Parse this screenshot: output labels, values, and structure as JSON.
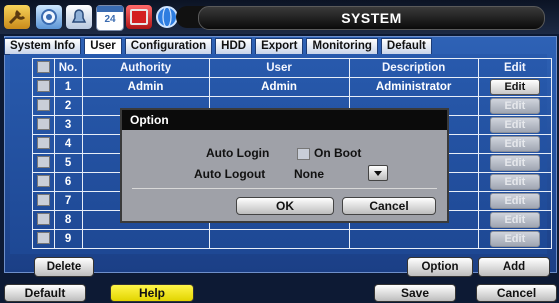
{
  "window": {
    "title": "SYSTEM"
  },
  "toolbar_icons": [
    "wrench-icon",
    "gear-icon",
    "bell-icon",
    "calendar-icon",
    "record-icon",
    "network-globe-icon"
  ],
  "calendar_icon_text": "24",
  "tabs": [
    {
      "label": "System Info",
      "active": false
    },
    {
      "label": "User",
      "active": true
    },
    {
      "label": "Configuration",
      "active": false
    },
    {
      "label": "HDD",
      "active": false
    },
    {
      "label": "Export",
      "active": false
    },
    {
      "label": "Monitoring",
      "active": false
    },
    {
      "label": "Default",
      "active": false
    }
  ],
  "table": {
    "headers": {
      "no": "No.",
      "authority": "Authority",
      "user": "User",
      "description": "Description",
      "edit": "Edit"
    },
    "rows": [
      {
        "no": "1",
        "authority": "Admin",
        "user": "Admin",
        "description": "Administrator",
        "edit": "Edit",
        "enabled": true
      },
      {
        "no": "2",
        "authority": "",
        "user": "",
        "description": "",
        "edit": "Edit",
        "enabled": false
      },
      {
        "no": "3",
        "authority": "",
        "user": "",
        "description": "",
        "edit": "Edit",
        "enabled": false
      },
      {
        "no": "4",
        "authority": "",
        "user": "",
        "description": "",
        "edit": "Edit",
        "enabled": false
      },
      {
        "no": "5",
        "authority": "",
        "user": "",
        "description": "",
        "edit": "Edit",
        "enabled": false
      },
      {
        "no": "6",
        "authority": "",
        "user": "",
        "description": "",
        "edit": "Edit",
        "enabled": false
      },
      {
        "no": "7",
        "authority": "",
        "user": "",
        "description": "",
        "edit": "Edit",
        "enabled": false
      },
      {
        "no": "8",
        "authority": "",
        "user": "",
        "description": "",
        "edit": "Edit",
        "enabled": false
      },
      {
        "no": "9",
        "authority": "",
        "user": "",
        "description": "",
        "edit": "Edit",
        "enabled": false
      }
    ]
  },
  "actions": {
    "delete": "Delete",
    "option": "Option",
    "add": "Add"
  },
  "dialog": {
    "title": "Option",
    "auto_login_label": "Auto Login",
    "on_boot_label": "On Boot",
    "auto_logout_label": "Auto Logout",
    "auto_logout_value": "None",
    "ok": "OK",
    "cancel": "Cancel"
  },
  "footer": {
    "default": "Default",
    "help": "Help",
    "save": "Save",
    "cancel": "Cancel"
  },
  "colors": {
    "panel": "#2a5cb0",
    "help_button": "#f2e400",
    "dialog_bg": "#9fa1a8"
  }
}
